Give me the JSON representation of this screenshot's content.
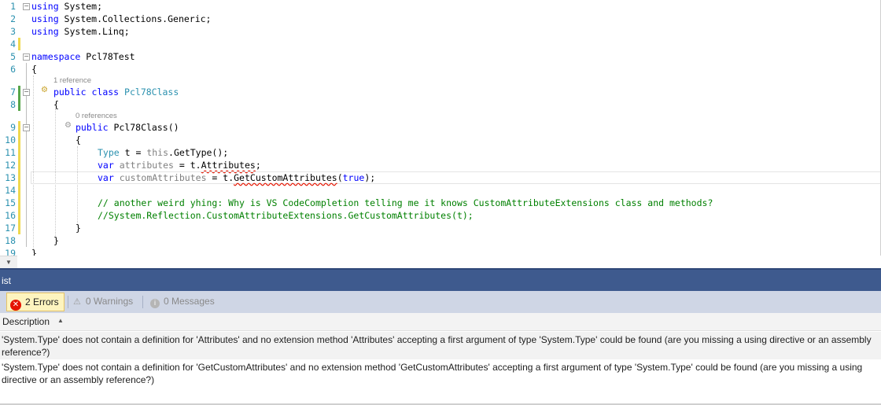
{
  "editor": {
    "lens_class": "1 reference",
    "lens_ctor": "0 references",
    "lines": {
      "l1_num": "1",
      "l2_num": "2",
      "l3_num": "3",
      "l4_num": "4",
      "l5_num": "5",
      "l6_num": "6",
      "l7_num": "7",
      "l8_num": "8",
      "l9_num": "9",
      "l10_num": "10",
      "l11_num": "11",
      "l12_num": "12",
      "l13_num": "13",
      "l14_num": "14",
      "l15_num": "15",
      "l16_num": "16",
      "l17_num": "17",
      "l18_num": "18",
      "l19_num": "19"
    },
    "tokens": {
      "using": "using",
      "system": " System;",
      "generic": " System.Collections.Generic;",
      "linq": " System.Linq;",
      "namespace": "namespace",
      "ns_name": " Pcl78Test",
      "brace_open": "{",
      "brace_close": "}",
      "public": "public",
      "class": "class",
      "class_name": "Pcl78Class",
      "ctor": " Pcl78Class()",
      "type": "Type",
      "t_eq": " t = ",
      "this": "this",
      "gettype": ".GetType();",
      "var": "var",
      "attributes_var": "attributes",
      "eq_t": " = t.",
      "attributes_prop": "Attributes",
      "semi": ";",
      "customattributes_var": "customAttributes",
      "getcustom": "GetCustomAttributes",
      "paren_open": "(",
      "true": "true",
      "paren_close": ");",
      "comment1": "// another weird yhing: Why is VS CodeCompletion telling me it knows CustomAttributeExtensions class and methods?",
      "comment2": "//System.Reflection.CustomAttributeExtensions.GetCustomAttributes(t);"
    }
  },
  "error_list": {
    "title": "ist",
    "errors_label": "2 Errors",
    "warnings_label": "0 Warnings",
    "messages_label": "0 Messages",
    "column_description": "Description",
    "rows": [
      {
        "description": "'System.Type' does not contain a definition for 'Attributes' and no extension method 'Attributes' accepting a first argument of type 'System.Type' could be found (are you missing a using directive or an assembly reference?)"
      },
      {
        "description": "'System.Type' does not contain a definition for 'GetCustomAttributes' and no extension method 'GetCustomAttributes' accepting a first argument of type 'System.Type' could be found (are you missing a using directive or an assembly reference?)"
      }
    ]
  },
  "colors": {
    "keyword": "#0000ff",
    "type": "#2b91af",
    "comment": "#008000",
    "error": "#e51400",
    "panel_title": "#3e5a8e",
    "toolbar": "#cfd6e5"
  }
}
